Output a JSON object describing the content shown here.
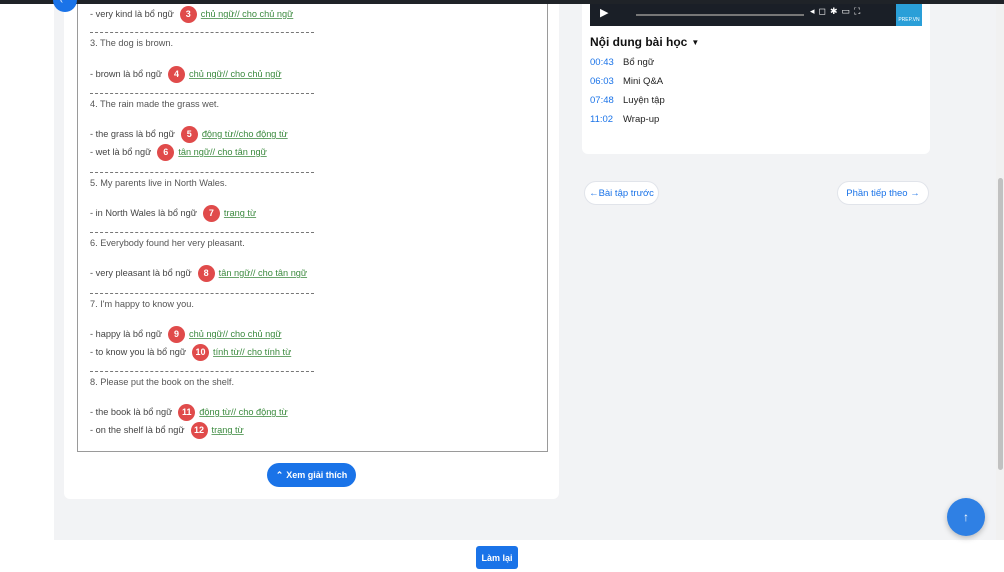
{
  "explanation": {
    "lines": [
      {
        "type": "ans",
        "text": "- very kind là bổ ngữ",
        "num": "3",
        "answer": "chủ ngữ// cho chủ ngữ"
      },
      {
        "type": "q",
        "text": "3. The dog is brown."
      },
      {
        "type": "ans",
        "text": "- brown là bổ ngữ",
        "num": "4",
        "answer": "chủ ngữ// cho chủ ngữ"
      },
      {
        "type": "q",
        "text": "4. The rain made the grass wet."
      },
      {
        "type": "ans",
        "text": "- the grass là bổ ngữ",
        "num": "5",
        "answer": "động từ//cho động từ"
      },
      {
        "type": "ans",
        "text": "- wet là bổ ngữ",
        "num": "6",
        "answer": "tân ngữ// cho tân ngữ"
      },
      {
        "type": "q",
        "text": "5. My parents live in North Wales."
      },
      {
        "type": "ans",
        "text": "- in North Wales là bổ ngữ",
        "num": "7",
        "answer": "trạng từ"
      },
      {
        "type": "q",
        "text": "6. Everybody found her very pleasant."
      },
      {
        "type": "ans",
        "text": "- very pleasant là bổ ngữ",
        "num": "8",
        "answer": "tân ngữ// cho tân ngữ"
      },
      {
        "type": "q",
        "text": "7. I'm happy to know you."
      },
      {
        "type": "ans",
        "text": "- happy là bổ ngữ",
        "num": "9",
        "answer": "chủ ngữ// cho chủ ngữ"
      },
      {
        "type": "ans",
        "text": "- to know you là bổ ngữ",
        "num": "10",
        "answer": "tính từ// cho tính từ"
      },
      {
        "type": "q",
        "text": "8. Please put the book on the shelf."
      },
      {
        "type": "ans",
        "text": "- the book là bổ ngữ",
        "num": "11",
        "answer": "động từ// cho động từ"
      },
      {
        "type": "ans",
        "text": "- on the shelf là bổ ngữ",
        "num": "12",
        "answer": "trạng từ"
      }
    ],
    "toggle_label": "Xem giải thích",
    "toggle_icon": "chevron-up-icon"
  },
  "video": {
    "logo_text": "PREP.VN",
    "play_icon": "play-icon",
    "control_icons": [
      "volume-icon",
      "captions-icon",
      "settings-icon",
      "pip-icon",
      "fullscreen-icon"
    ]
  },
  "lesson": {
    "title": "Nội dung bài học",
    "items": [
      {
        "time": "00:43",
        "name": "Bổ ngữ"
      },
      {
        "time": "06:03",
        "name": "Mini Q&A"
      },
      {
        "time": "07:48",
        "name": "Luyện tập"
      },
      {
        "time": "11:02",
        "name": "Wrap-up"
      }
    ]
  },
  "nav": {
    "prev_label": "←Bài tập trước",
    "next_label": "Phần tiếp theo  →"
  },
  "footer": {
    "retry_label": "Làm lại",
    "scroll_top_icon": "arrow-up-icon"
  },
  "colors": {
    "accent": "#1a73e8",
    "badge": "#e04b4b",
    "answer": "#3b8a3e"
  }
}
